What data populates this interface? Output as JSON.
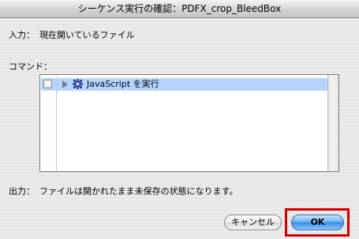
{
  "dialog": {
    "title": "シーケンス実行の確認：PDFX_crop_BleedBox"
  },
  "input": {
    "label": "入力：",
    "value": "現在開いているファイル"
  },
  "commands": {
    "label": "コマンド：",
    "items": [
      {
        "checked": false,
        "expanded": false,
        "label": "JavaScript を実行",
        "icon": "gear-icon"
      }
    ]
  },
  "output": {
    "label": "出力：",
    "value": "ファイルは開かれたまま未保存の状態になります。"
  },
  "buttons": {
    "cancel_label": "キャンセル",
    "ok_label": "OK"
  },
  "annotation": {
    "highlight_color": "#d40000"
  }
}
